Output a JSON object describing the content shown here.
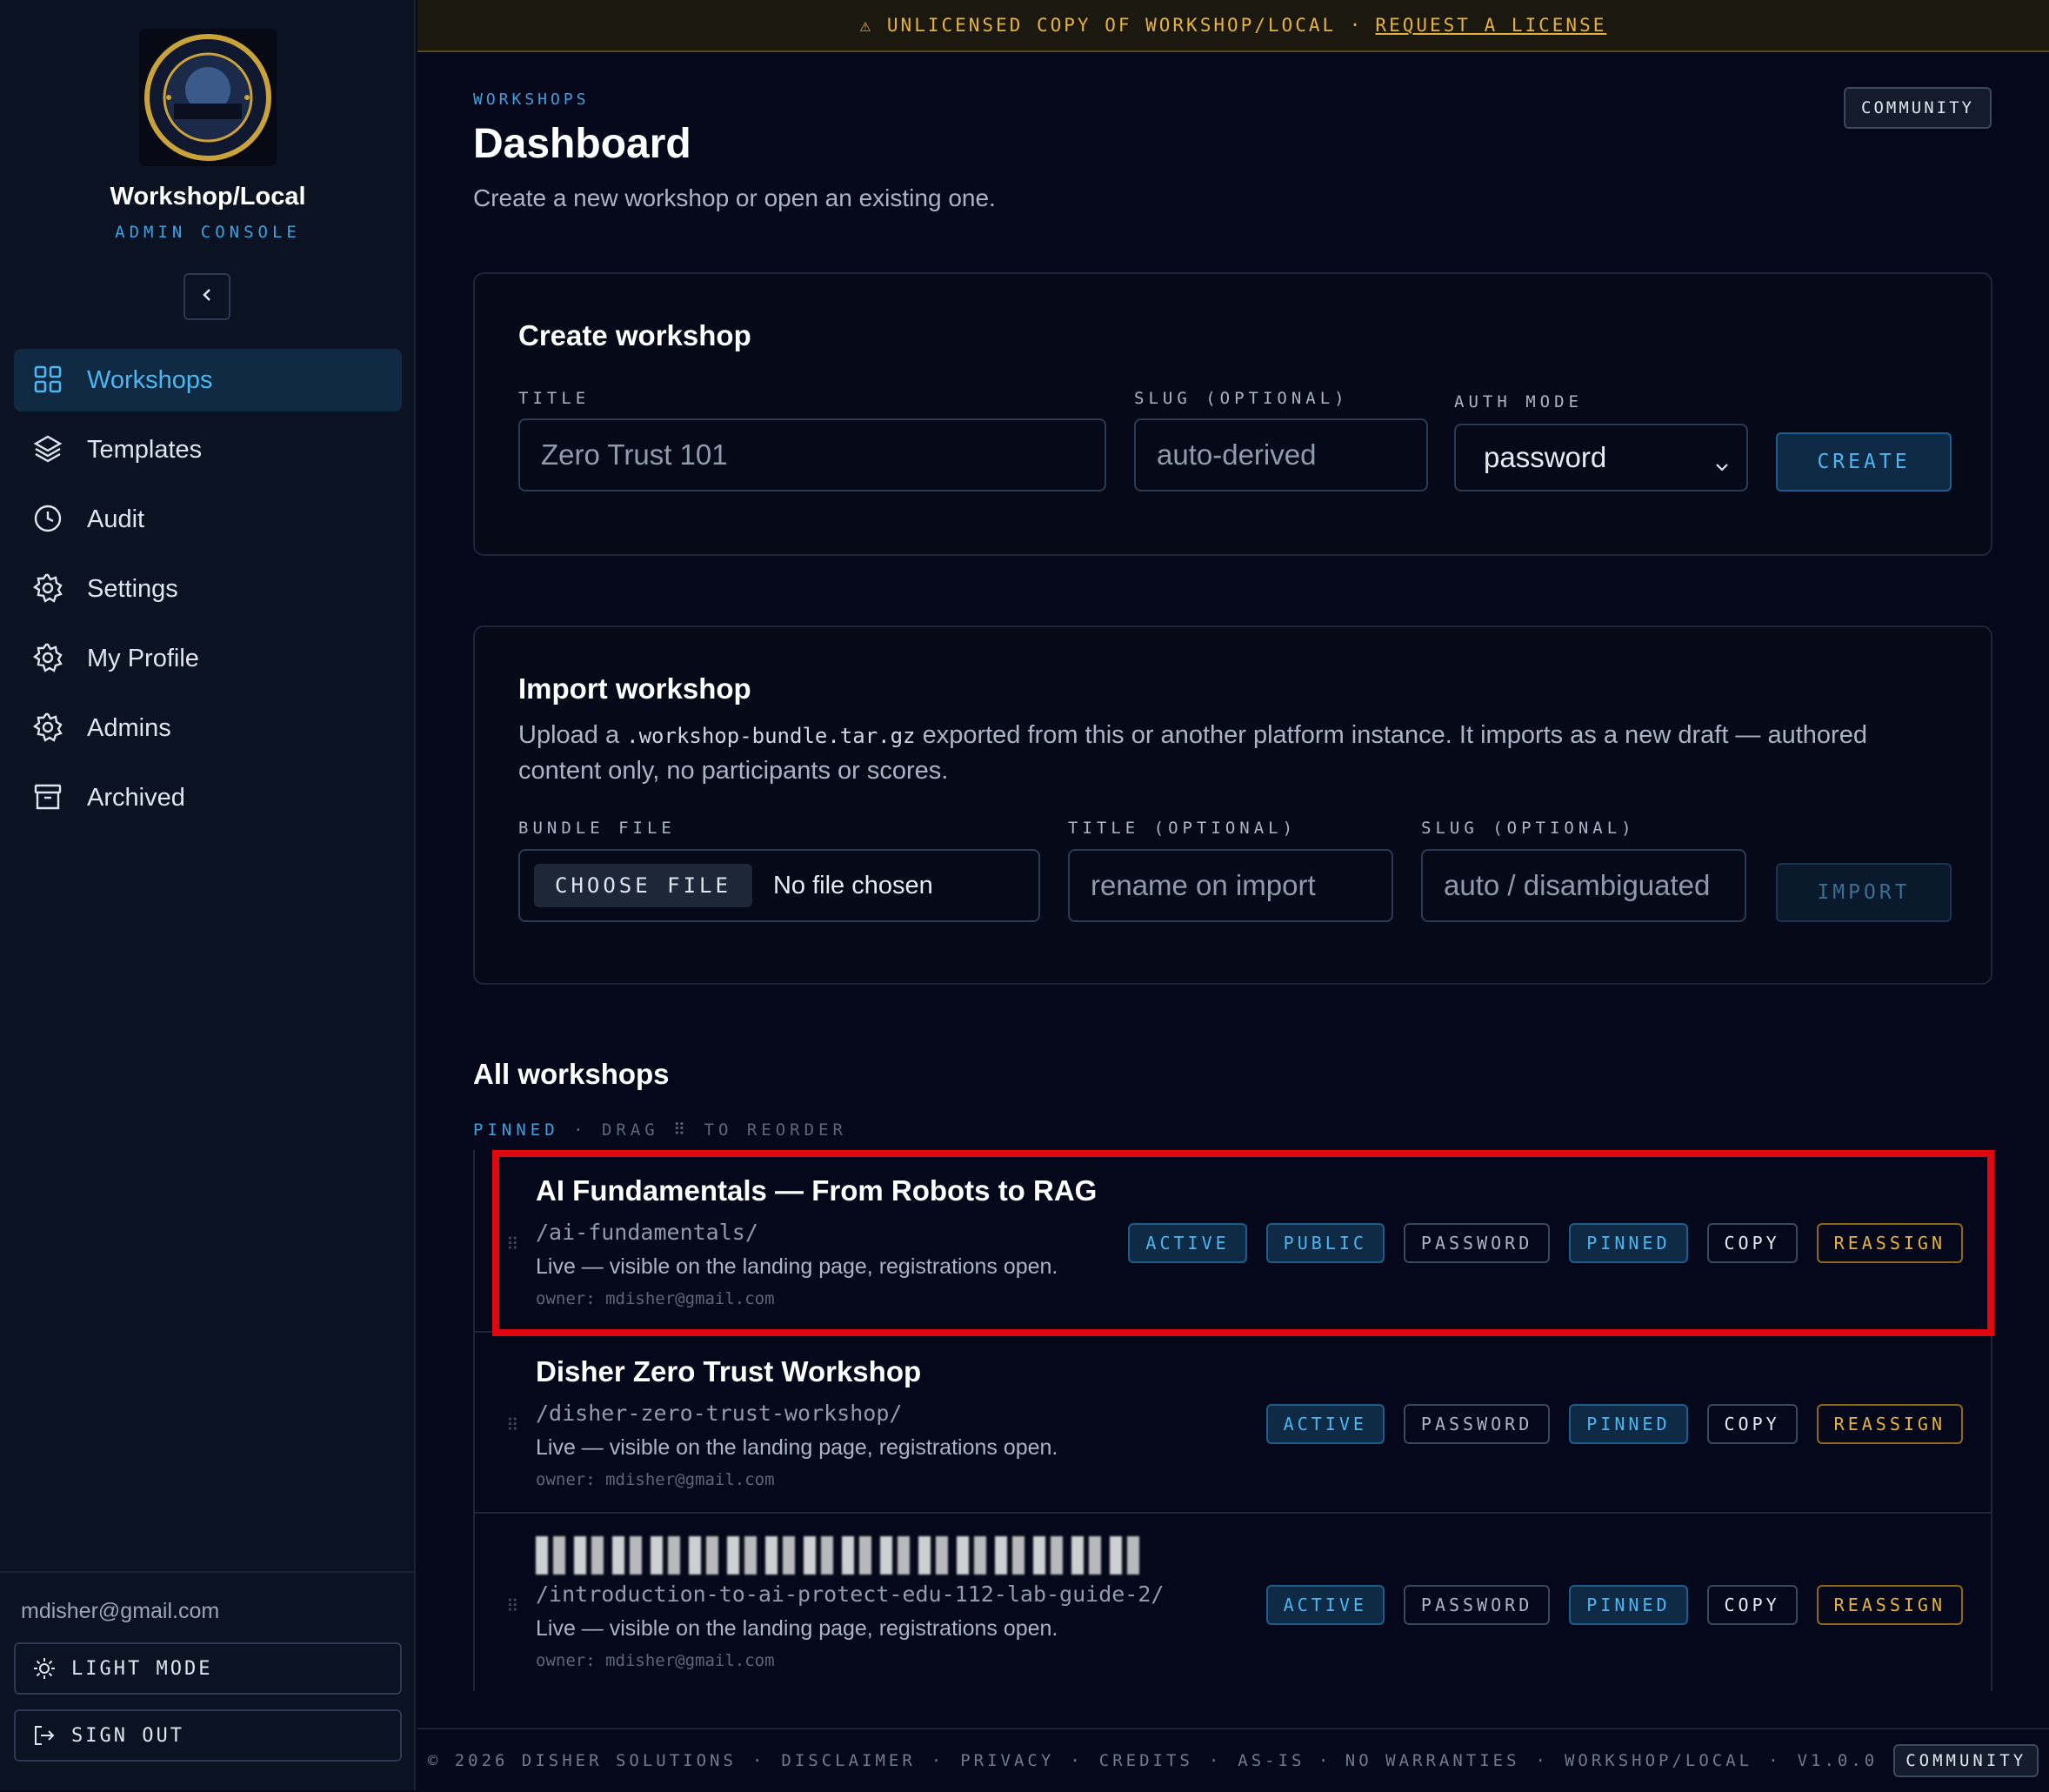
{
  "app": {
    "name": "Workshop/Local",
    "subtitle": "ADMIN CONSOLE",
    "logo_icon": "workshop-control-badge",
    "colors": {
      "accent": "#3fa0e0",
      "warning": "#e6b23a",
      "background": "#05081a"
    }
  },
  "banner": {
    "text": "⚠ UNLICENSED COPY OF WORKSHOP/LOCAL  ·",
    "link": "REQUEST A LICENSE"
  },
  "sidebar": {
    "items": [
      {
        "label": "Workshops",
        "icon": "grid-icon",
        "active": true
      },
      {
        "label": "Templates",
        "icon": "layers-icon"
      },
      {
        "label": "Audit",
        "icon": "clock-icon"
      },
      {
        "label": "Settings",
        "icon": "gear-icon"
      },
      {
        "label": "My Profile",
        "icon": "gear-icon"
      },
      {
        "label": "Admins",
        "icon": "gear-icon"
      },
      {
        "label": "Archived",
        "icon": "archive-icon"
      }
    ],
    "email": "mdisher@gmail.com",
    "light_mode": "LIGHT MODE",
    "sign_out": "SIGN OUT"
  },
  "header": {
    "breadcrumb": "WORKSHOPS",
    "title": "Dashboard",
    "subtitle": "Create a new workshop or open an existing one.",
    "edition_badge": "COMMUNITY"
  },
  "create": {
    "title": "Create workshop",
    "title_label": "TITLE",
    "title_placeholder": "Zero Trust 101",
    "slug_label": "SLUG (OPTIONAL)",
    "slug_placeholder": "auto-derived",
    "auth_label": "AUTH MODE",
    "auth_value": "password",
    "button": "CREATE"
  },
  "import": {
    "title": "Import workshop",
    "desc_before": "Upload a",
    "desc_code": ".workshop-bundle.tar.gz",
    "desc_after": "exported from this or another platform instance. It imports as a new draft — authored content only, no participants or scores.",
    "file_label": "BUNDLE FILE",
    "choose_button": "CHOOSE FILE",
    "no_file": "No file chosen",
    "title_label": "TITLE (OPTIONAL)",
    "title_placeholder": "rename on import",
    "slug_label": "SLUG (OPTIONAL)",
    "slug_placeholder": "auto / disambiguated",
    "button": "IMPORT"
  },
  "list": {
    "title": "All workshops",
    "pinned_label": "PINNED",
    "drag_hint": "· DRAG ⠿ TO REORDER",
    "workshops": [
      {
        "title": "AI Fundamentals — From Robots to RAG",
        "slug": "/ai-fundamentals/",
        "desc": "Live — visible on the landing page, registrations open.",
        "owner": "owner: mdisher@gmail.com",
        "tags": [
          "ACTIVE",
          "PUBLIC",
          "PASSWORD",
          "PINNED",
          "COPY",
          "REASSIGN"
        ]
      },
      {
        "title": "Disher Zero Trust Workshop",
        "slug": "/disher-zero-trust-workshop/",
        "desc": "Live — visible on the landing page, registrations open.",
        "owner": "owner: mdisher@gmail.com",
        "tags": [
          "ACTIVE",
          "PASSWORD",
          "PINNED",
          "COPY",
          "REASSIGN"
        ]
      },
      {
        "title": "",
        "slug": "/introduction-to-ai-protect-edu-112-lab-guide-2/",
        "desc": "Live — visible on the landing page, registrations open.",
        "owner": "owner: mdisher@gmail.com",
        "tags": [
          "ACTIVE",
          "PASSWORD",
          "PINNED",
          "COPY",
          "REASSIGN"
        ]
      }
    ]
  },
  "footer": {
    "items": [
      "© 2026 DISHER SOLUTIONS",
      "DISCLAIMER",
      "PRIVACY",
      "CREDITS",
      "AS-IS · NO WARRANTIES",
      "WORKSHOP/LOCAL",
      "V1.0.0"
    ],
    "badge": "COMMUNITY"
  }
}
